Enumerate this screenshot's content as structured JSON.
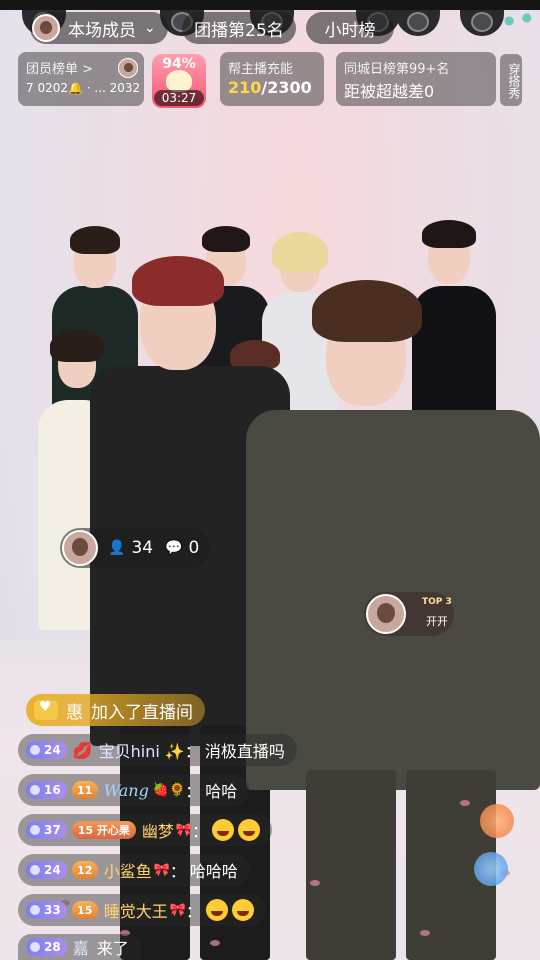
{
  "header": {
    "members_label": "本场成员",
    "team_rank": "团播第25名",
    "hourly_rank": "小时榜"
  },
  "stats": {
    "fans_title": "团员榜单 >",
    "fans_value": "7 0202🔔 · ... 2032",
    "gift_percent": "94%",
    "gift_timer": "03:27",
    "charge_title": "帮主播充能",
    "charge_current": "210",
    "charge_total": "/2300",
    "city_title": "同城日榜第99+名",
    "city_gap": "距被超越差0",
    "outfit_label": "穿搭秀"
  },
  "viewer": {
    "count": "34",
    "comments": "0"
  },
  "top3": {
    "label": "TOP 3",
    "name": "开开"
  },
  "chat": {
    "join": {
      "user": "惠",
      "text": "加入了直播间"
    },
    "rows": [
      {
        "level": "24",
        "user": "宝贝hini ✨",
        "colon": "：",
        "text": "消极直播吗"
      },
      {
        "level": "16",
        "fan": "11",
        "user": "Wang",
        "colon": "：",
        "text": "哈哈"
      },
      {
        "level": "37",
        "fan": "15",
        "fan_name": "开心果",
        "user": "幽梦",
        "colon": "：",
        "text": ""
      },
      {
        "level": "24",
        "fan": "12",
        "user": "小鲨鱼",
        "colon": "：",
        "text": "哈哈哈"
      },
      {
        "level": "33",
        "fan": "15",
        "user": "睡觉大王",
        "colon": "：",
        "text": ""
      },
      {
        "level": "28",
        "user": "嘉",
        "text": "来了"
      }
    ]
  },
  "colors": {
    "gold": "#ffd84a",
    "join_bg": "#e9b026",
    "level_badge": "#7b7ff0",
    "fan_badge": "#f6b15a"
  }
}
